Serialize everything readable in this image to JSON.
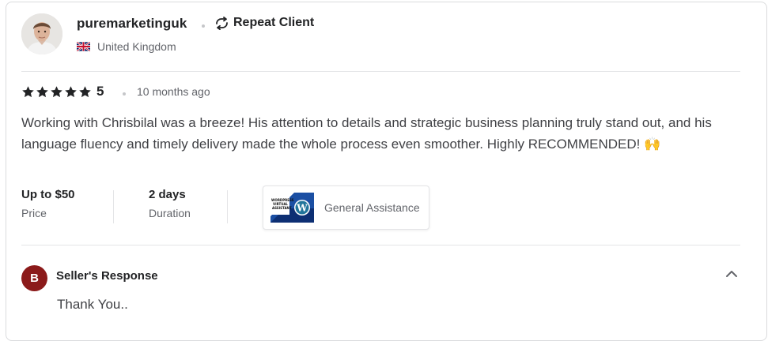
{
  "reviewer": {
    "username": "puremarketinguk",
    "badge": "Repeat Client",
    "country": "United Kingdom",
    "avatar_icon": "person-photo"
  },
  "rating": {
    "stars": 5,
    "value": "5",
    "time_ago": "10 months ago",
    "star_color": "#222325"
  },
  "review_text": "Working with Chrisbilal was a breeze! His attention to details and strategic business planning truly stand out, and his language fluency and timely delivery made the whole process even smoother. Highly RECOMMENDED! 🙌",
  "details": {
    "price_value": "Up to $50",
    "price_label": "Price",
    "duration_value": "2 days",
    "duration_label": "Duration"
  },
  "service": {
    "name": "General Assistance",
    "thumb_text": "WORDPRESS VIRTUAL ASSISTANT"
  },
  "seller_response": {
    "initial": "B",
    "title": "Seller's Response",
    "text": "Thank You..",
    "avatar_color": "#8b1a1a"
  }
}
